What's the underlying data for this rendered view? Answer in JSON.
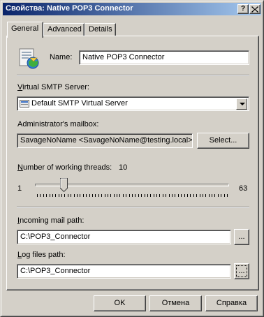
{
  "window": {
    "title": "Свойства: Native POP3 Connector",
    "help_button": "?",
    "close_button": "X"
  },
  "tabs": [
    {
      "label": "General",
      "active": true
    },
    {
      "label": "Advanced",
      "active": false
    },
    {
      "label": "Details",
      "active": false
    }
  ],
  "general": {
    "icon": "pop3-connector-icon",
    "name_label": "Name:",
    "name_value": "Native POP3 Connector",
    "smtp_server_label": "Virtual SMTP Server:",
    "smtp_server_value": "Default SMTP Virtual Server",
    "mailbox_label": "Administrator's mailbox:",
    "mailbox_value": "SavageNoName <SavageNoName@testing.local>",
    "select_button": "Select...",
    "threads_label": "Number of working threads:",
    "threads_value": "10",
    "slider_min": "1",
    "slider_max": "63",
    "incoming_path_label": "Incoming mail path:",
    "incoming_path_value": "C:\\POP3_Connector",
    "incoming_browse_button": "...",
    "log_path_label": "Log files path:",
    "log_path_value": "C:\\POP3_Connector",
    "log_browse_button": "..."
  },
  "footer": {
    "ok_button": "OK",
    "cancel_button": "Отмена",
    "help_button": "Справка"
  }
}
